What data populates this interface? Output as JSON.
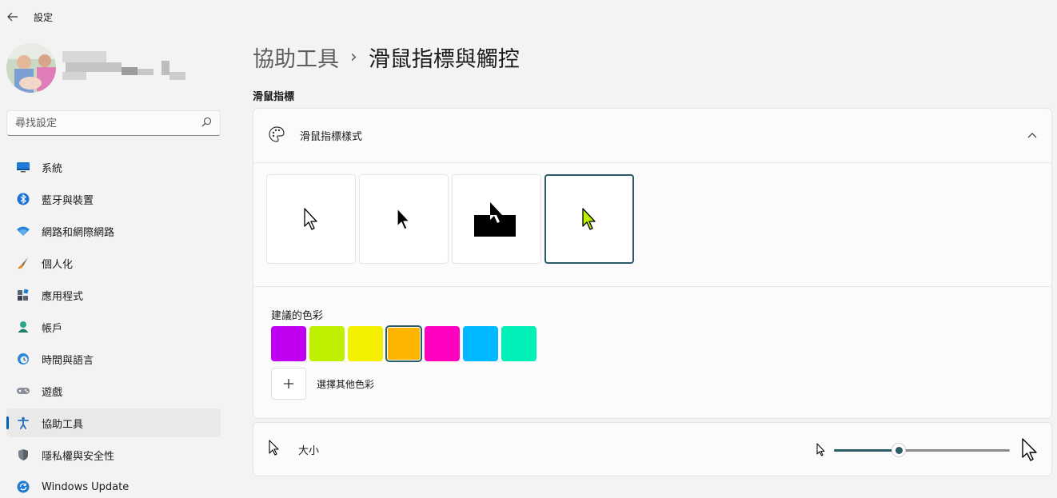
{
  "app": {
    "title": "設定"
  },
  "search": {
    "placeholder": "尋找設定"
  },
  "sidebar": {
    "items": [
      {
        "label": "系統",
        "icon": "monitor-icon"
      },
      {
        "label": "藍牙與裝置",
        "icon": "bluetooth-icon"
      },
      {
        "label": "網路和網際網路",
        "icon": "wifi-icon"
      },
      {
        "label": "個人化",
        "icon": "brush-icon"
      },
      {
        "label": "應用程式",
        "icon": "apps-icon"
      },
      {
        "label": "帳戶",
        "icon": "person-icon"
      },
      {
        "label": "時間與語言",
        "icon": "globe-clock-icon"
      },
      {
        "label": "遊戲",
        "icon": "gamepad-icon"
      },
      {
        "label": "協助工具",
        "icon": "accessibility-icon",
        "active": true
      },
      {
        "label": "隱私權與安全性",
        "icon": "shield-icon"
      },
      {
        "label": "Windows Update",
        "icon": "update-icon"
      }
    ]
  },
  "breadcrumb": {
    "parent": "協助工具",
    "separator": "›",
    "current": "滑鼠指標與觸控"
  },
  "section": {
    "label": "滑鼠指標"
  },
  "pointer_style": {
    "label": "滑鼠指標樣式",
    "options": [
      "white",
      "black",
      "inverted",
      "custom"
    ],
    "selected": "custom"
  },
  "colors": {
    "label": "建議的色彩",
    "swatches": [
      "#c000f0",
      "#bff000",
      "#f5f000",
      "#ffb400",
      "#ff00c0",
      "#00b8ff",
      "#00f0b8"
    ],
    "selected_index": 3,
    "custom_label": "選擇其他色彩"
  },
  "size": {
    "label": "大小",
    "value_fraction": 0.37
  },
  "accent": "#2b5b66",
  "custom_cursor_color": "#bff000"
}
